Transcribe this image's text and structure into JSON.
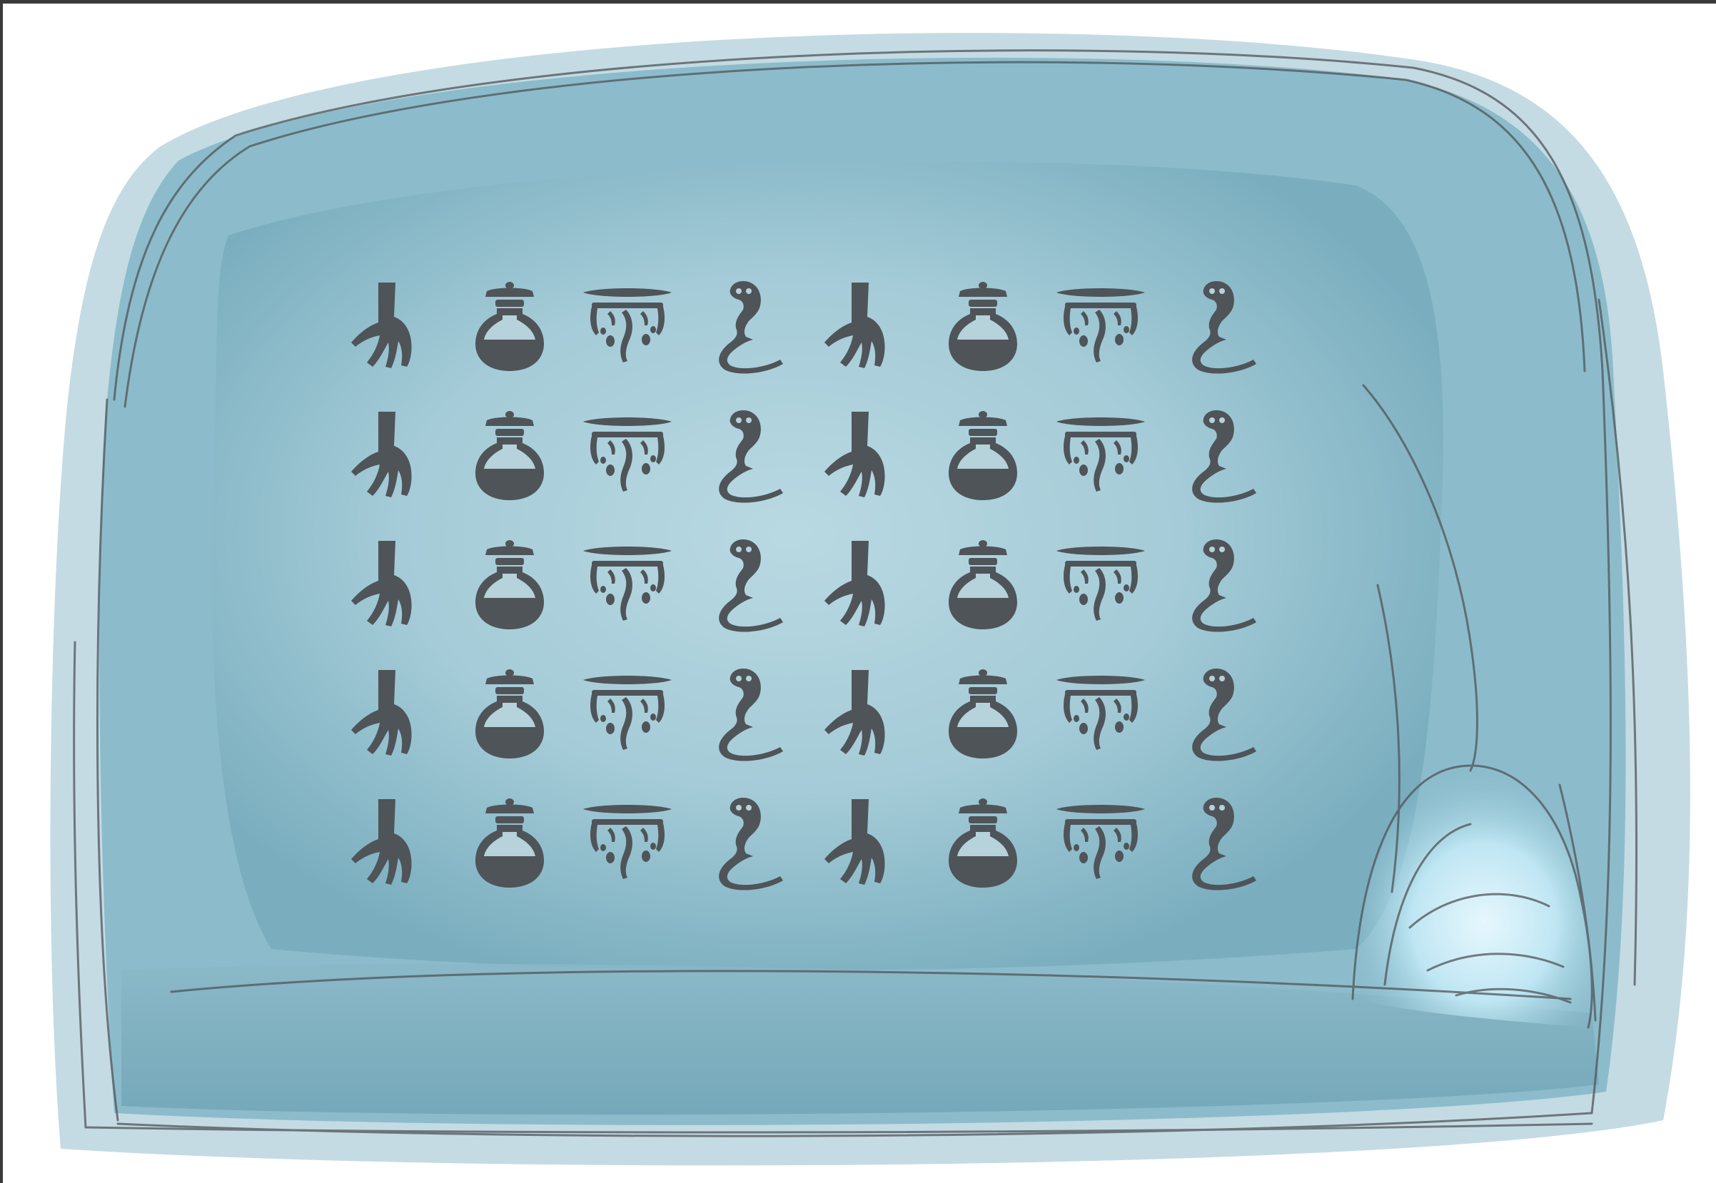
{
  "scene": {
    "panel_color": "#7fb0c0",
    "panel_light_color": "#b6d6df",
    "outline_color": "#555a60",
    "glyph_color": "#4f5459",
    "cave_glow_color": "#d8f1fb"
  },
  "glyph_cycle": [
    "hand-icon",
    "jar-icon",
    "rain-cloud-icon",
    "cobra-icon"
  ],
  "glyph_grid": {
    "rows": [
      [
        "hand-icon",
        "jar-icon",
        "rain-cloud-icon",
        "cobra-icon",
        "hand-icon",
        "jar-icon",
        "rain-cloud-icon",
        "cobra-icon"
      ],
      [
        "hand-icon",
        "jar-icon",
        "rain-cloud-icon",
        "cobra-icon",
        "hand-icon",
        "jar-icon",
        "rain-cloud-icon",
        "cobra-icon"
      ],
      [
        "hand-icon",
        "jar-icon",
        "rain-cloud-icon",
        "cobra-icon",
        "hand-icon",
        "jar-icon",
        "rain-cloud-icon",
        "cobra-icon"
      ],
      [
        "hand-icon",
        "jar-icon",
        "rain-cloud-icon",
        "cobra-icon",
        "hand-icon",
        "jar-icon",
        "rain-cloud-icon",
        "cobra-icon"
      ],
      [
        "hand-icon",
        "jar-icon",
        "rain-cloud-icon",
        "cobra-icon",
        "hand-icon",
        "jar-icon",
        "rain-cloud-icon",
        "cobra-icon"
      ]
    ]
  }
}
